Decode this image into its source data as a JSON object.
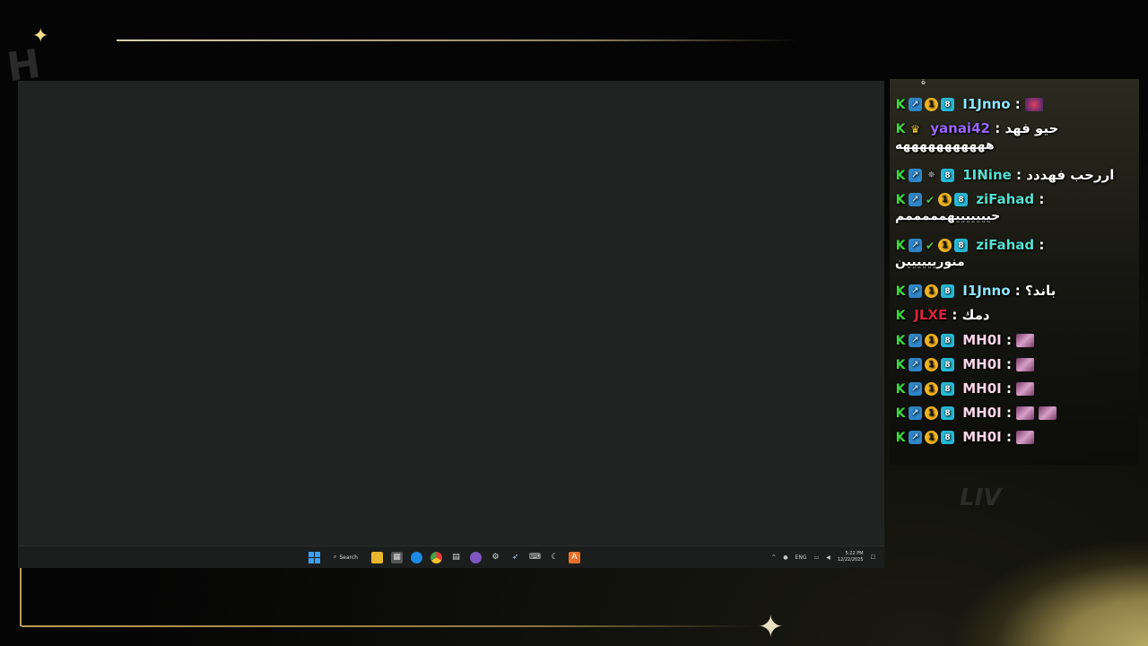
{
  "taskbar": {
    "search_label": "Search",
    "lang": "ENG",
    "time": "5:22 PM",
    "date": "12/22/2025"
  },
  "chat": {
    "top_glyph": "ة",
    "messages": [
      {
        "user": "I1Jnno",
        "text": "",
        "emote": "red"
      },
      {
        "user": "yanai42",
        "text": "حيو فهد",
        "line2": "هههههههههههه"
      },
      {
        "user": "1INine",
        "text": "اررحب فهددد"
      },
      {
        "user": "ziFahad",
        "text": "",
        "line2": "حيييييييهمممممم"
      },
      {
        "user": "ziFahad",
        "text": "",
        "line2": "منوريييييين"
      },
      {
        "user": "I1Jnno",
        "text": "باند؟"
      },
      {
        "user": "JLXE",
        "text": "دمك"
      },
      {
        "user": "MH0I",
        "emote": "pink"
      },
      {
        "user": "MH0I",
        "emote": "pink"
      },
      {
        "user": "MH0I",
        "emote": "pink"
      },
      {
        "user": "MH0I",
        "emote": "pink2"
      },
      {
        "user": "MH0I",
        "emote": "pink"
      }
    ],
    "separator": ":"
  },
  "icons": {
    "start": "windows-start-icon",
    "search": "search-icon",
    "explorer": "folder-icon",
    "store": "store-icon",
    "edge": "edge-icon",
    "chrome": "chrome-icon",
    "tray": [
      "chevron-up-icon",
      "microphone-icon",
      "wifi-icon",
      "speaker-icon",
      "notification-icon"
    ]
  }
}
